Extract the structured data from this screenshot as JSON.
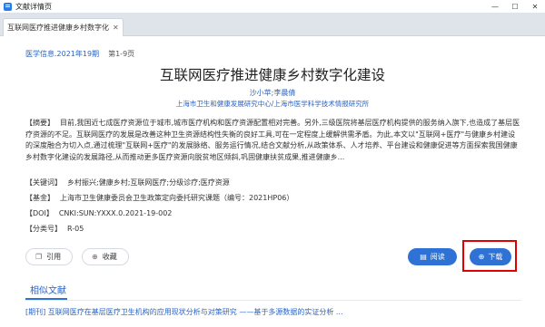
{
  "window": {
    "title": "文献详情页",
    "controls": [
      "—",
      "☐",
      "✕"
    ]
  },
  "tab": {
    "label": "互联网医疗推进健康乡村数字化建设",
    "close": "✕"
  },
  "meta": {
    "journal": "医学信息.2021年19期",
    "pages": "第1-9页"
  },
  "doc": {
    "title": "互联网医疗推进健康乡村数字化建设",
    "authors": "沙小苹;李晨倩",
    "orgs": "上海市卫生和健康发展研究中心/上海市医学科学技术情报研究所"
  },
  "fields": {
    "abstract_key": "【摘要】",
    "abstract_val": "目前,我国近七成医疗资源位于城市,城市医疗机构和医疗资源配置相对完善。另外,三级医院将基层医疗机构提供的服务纳入旗下,也造成了基层医疗资源的不足。互联网医疗的发展是改善这种卫生资源结构性失衡的良好工具,可在一定程度上缓解供需矛盾。为此,本文以\"互联网+医疗\"与健康乡村建设的深度融合为切入点,通过梳理\"互联网+医疗\"的发展脉络、服务运行情况,结合文献分析,从政策体系、人才培养、平台建设和健康促进等方面探索我国健康乡村数字化建设的发展路径,从而推动更多医疗资源向脱贫地区倾斜,巩固健康扶贫成果,推进健康乡...",
    "keywords_key": "【关键词】",
    "keywords_val": "乡村振兴;健康乡村;互联网医疗;分级诊疗;医疗资源",
    "fund_key": "【基金】",
    "fund_val": "上海市卫生健康委员会卫生政策定向委托研究课题（编号：2021HP06）",
    "doi_key": "【DOI】",
    "doi_val": "CNKI:SUN:YXXX.0.2021-19-002",
    "clc_key": "【分类号】",
    "clc_val": "R-05"
  },
  "actions": {
    "cite": "引用",
    "fav": "收藏",
    "read": "阅读",
    "download": "下载"
  },
  "related": {
    "title": "相似文献",
    "first_item": "[期刊] 互联网医疗在基层医疗卫生机构的应用现状分析与对策研究 ——基于多源数据的实证分析 ..."
  },
  "colors": {
    "accent": "#2f72d6",
    "link": "#2a64c5",
    "highlight": "#e00000"
  }
}
